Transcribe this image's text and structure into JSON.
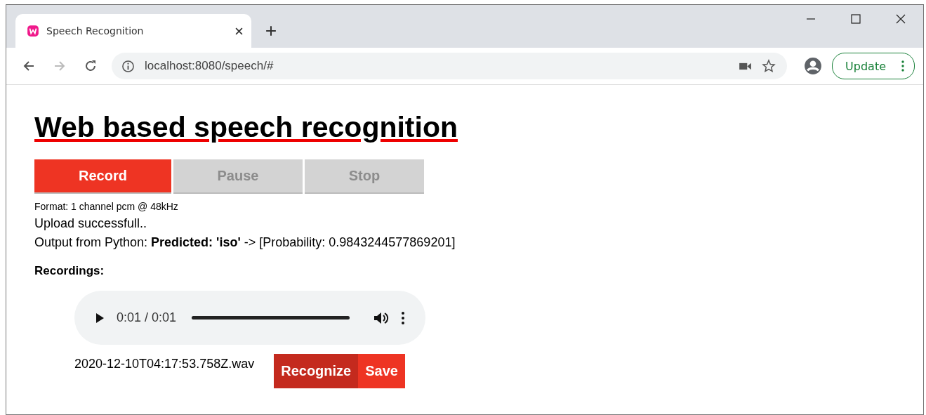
{
  "browser": {
    "tab": {
      "title": "Speech Recognition",
      "selected": true
    },
    "url": "localhost:8080/speech/#",
    "update_button": "Update"
  },
  "page": {
    "title": "Web based speech recognition",
    "controls": [
      {
        "label": "Record",
        "disabled": false
      },
      {
        "label": "Pause",
        "disabled": true
      },
      {
        "label": "Stop",
        "disabled": true
      }
    ],
    "format": "Format: 1 channel pcm @ 48kHz",
    "status": "Upload successfull..",
    "output": "Output from Python: **Predicted: 'iso'** -> [Probability: 0.9843244577869201]",
    "recordings_heading": "Recordings:",
    "recordings": [
      {
        "time": "0:01 / 0:01",
        "level": 1,
        "filename": "2020-12-10T04:17:53.758Z.wav",
        "actions": [
          "Recognize",
          "Save"
        ]
      }
    ]
  }
}
